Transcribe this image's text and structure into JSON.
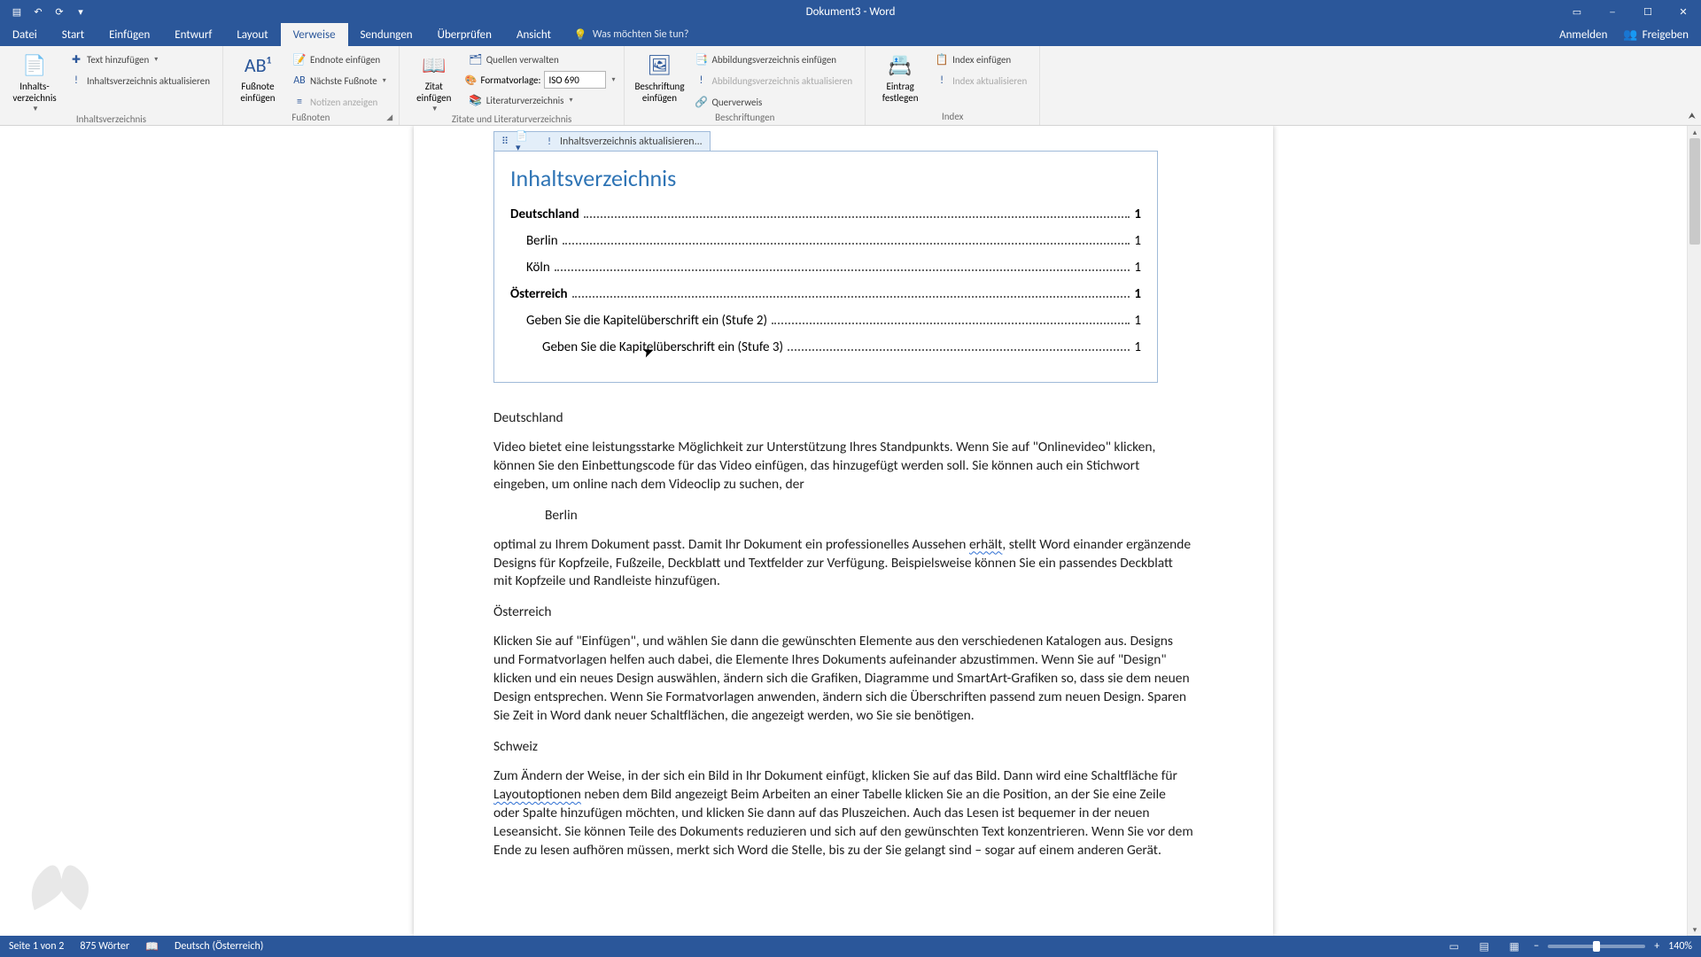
{
  "title": "Dokument3 - Word",
  "qat": {
    "save": "💾",
    "undo": "↶",
    "redo": "↻",
    "repeat": "⟳",
    "touch": "✋"
  },
  "tabs": {
    "file": "Datei",
    "items": [
      "Start",
      "Einfügen",
      "Entwurf",
      "Layout",
      "Verweise",
      "Sendungen",
      "Überprüfen",
      "Ansicht"
    ],
    "active_index": 4,
    "tellme_placeholder": "Was möchten Sie tun?",
    "signin": "Anmelden",
    "share": "Freigeben"
  },
  "ribbon": {
    "g_toc": {
      "label": "Inhaltsverzeichnis",
      "btn_toc_label": "Inhalts-verzeichnis",
      "btn_add_text": "Text hinzufügen",
      "btn_update": "Inhaltsverzeichnis aktualisieren"
    },
    "g_footnotes": {
      "label": "Fußnoten",
      "btn_insert_footnote": "Fußnote einfügen",
      "btn_endnote": "Endnote einfügen",
      "btn_next_footnote": "Nächste Fußnote",
      "btn_show_notes": "Notizen anzeigen"
    },
    "g_citations": {
      "label": "Zitate und Literaturverzeichnis",
      "btn_insert_cite": "Zitat einfügen",
      "btn_manage_sources": "Quellen verwalten",
      "style_label": "Formatvorlage:",
      "style_value": "ISO 690",
      "btn_bibliography": "Literaturverzeichnis"
    },
    "g_captions": {
      "label": "Beschriftungen",
      "btn_insert_caption": "Beschriftung einfügen",
      "btn_insert_tof": "Abbildungsverzeichnis einfügen",
      "btn_update_tof": "Abbildungsverzeichnis aktualisieren",
      "btn_crossref": "Querverweis"
    },
    "g_index": {
      "label": "Index",
      "btn_mark_entry": "Eintrag festlegen",
      "btn_insert_index": "Index einfügen",
      "btn_update_index": "Index aktualisieren"
    }
  },
  "toc_field_tab": "Inhaltsverzeichnis aktualisieren...",
  "toc": {
    "title": "Inhaltsverzeichnis",
    "entries": [
      {
        "level": 1,
        "text": "Deutschland",
        "page": "1"
      },
      {
        "level": 2,
        "text": "Berlin",
        "page": "1"
      },
      {
        "level": 2,
        "text": "Köln",
        "page": "1"
      },
      {
        "level": 1,
        "text": "Österreich",
        "page": "1"
      },
      {
        "level": 2,
        "text": "Geben Sie die Kapitelüberschrift ein (Stufe 2)",
        "page": "1"
      },
      {
        "level": 3,
        "text": "Geben Sie die Kapitelüberschrift ein (Stufe 3)",
        "page": "1"
      }
    ]
  },
  "document": {
    "h1": "Deutschland",
    "p1": "Video bietet eine leistungsstarke Möglichkeit zur Unterstützung Ihres Standpunkts. Wenn Sie auf \"Onlinevideo\" klicken, können Sie den Einbettungscode für das Video einfügen, das hinzugefügt werden soll. Sie können auch ein Stichwort eingeben, um online nach dem Videoclip zu suchen, der",
    "h2": "Berlin",
    "p2a": "optimal zu Ihrem Dokument passt. Damit Ihr Dokument ein professionelles Aussehen ",
    "p2_squiggle": "erhält",
    "p2b": ", stellt Word einander ergänzende Designs für Kopfzeile, Fußzeile, Deckblatt und Textfelder zur Verfügung. Beispielsweise können Sie ein passendes Deckblatt mit Kopfzeile und Randleiste hinzufügen.",
    "h3": "Österreich",
    "p3": "Klicken Sie auf \"Einfügen\", und wählen Sie dann die gewünschten Elemente aus den verschiedenen Katalogen aus. Designs und Formatvorlagen helfen auch dabei, die Elemente Ihres Dokuments aufeinander abzustimmen. Wenn Sie auf \"Design\" klicken und ein neues Design auswählen, ändern sich die Grafiken, Diagramme und SmartArt-Grafiken so, dass sie dem neuen Design entsprechen. Wenn Sie Formatvorlagen anwenden, ändern sich die Überschriften passend zum neuen Design. Sparen Sie Zeit in Word dank neuer Schaltflächen, die angezeigt werden, wo Sie sie benötigen.",
    "h4": "Schweiz",
    "p4a": "Zum Ändern der Weise, in der sich ein Bild in Ihr Dokument einfügt, klicken Sie auf das Bild. Dann wird eine Schaltfläche für ",
    "p4_squiggle": "Layoutoptionen",
    "p4b": " neben dem Bild angezeigt Beim Arbeiten an einer Tabelle klicken Sie an die Position, an der Sie eine Zeile oder Spalte hinzufügen möchten, und klicken Sie dann auf das Pluszeichen. Auch das Lesen ist bequemer in der neuen Leseansicht. Sie können Teile des Dokuments reduzieren und sich auf den gewünschten Text konzentrieren. Wenn Sie vor dem Ende zu lesen aufhören müssen, merkt sich Word die Stelle, bis zu der Sie gelangt sind – sogar auf einem anderen Gerät."
  },
  "statusbar": {
    "page": "Seite 1 von 2",
    "words": "875 Wörter",
    "lang": "Deutsch (Österreich)",
    "zoom": "140%"
  }
}
